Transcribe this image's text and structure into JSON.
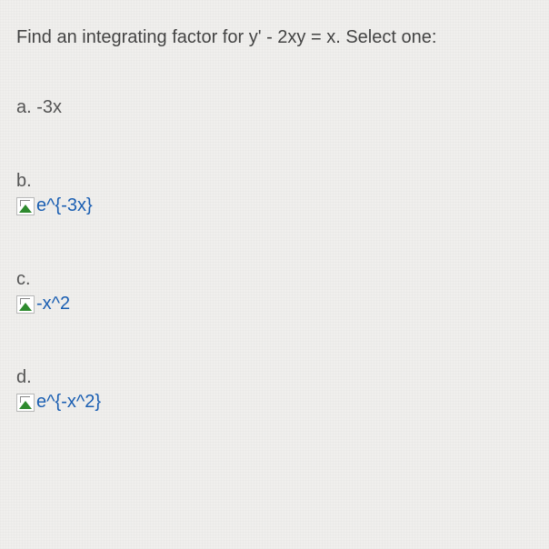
{
  "question": "Find an integrating factor for y' - 2xy = x. Select one:",
  "options": {
    "a": {
      "label": "a. -3x"
    },
    "b": {
      "label": "b.",
      "alt": "e^{-3x}"
    },
    "c": {
      "label": "c.",
      "alt": "-x^2"
    },
    "d": {
      "label": "d.",
      "alt": "e^{-x^2}"
    }
  }
}
